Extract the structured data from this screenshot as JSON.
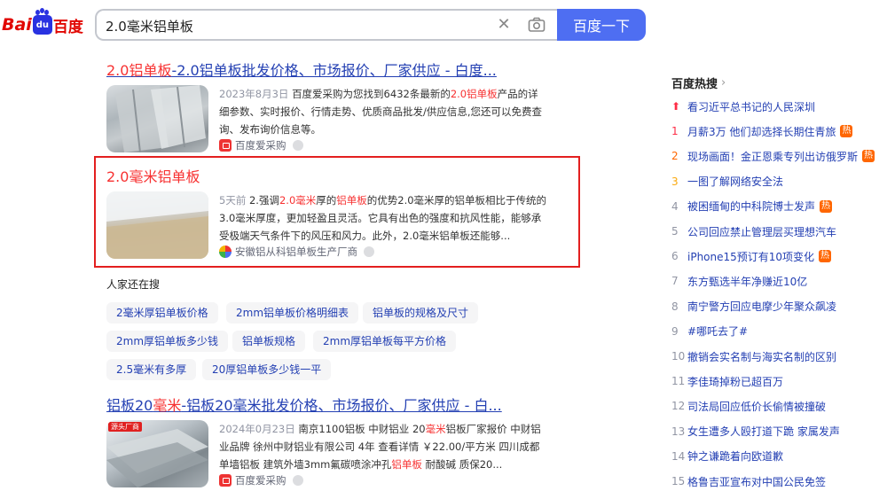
{
  "logo": {
    "bai": "Bai",
    "du": "du",
    "cn": "百度"
  },
  "search": {
    "query": "2.0毫米铝单板",
    "button": "百度一下"
  },
  "results": [
    {
      "title_hl": "2.0铝单板",
      "title_rest": "-2.0铝单板批发价格、市场报价、厂家供应 - 白度...",
      "date": "2023年8月3日",
      "desc_a": "百度爱采购为您找到6432条最新的",
      "desc_hl": "2.0铝单板",
      "desc_b": "产品的详细参数、实时报价、行情走势、优质商品批发/供应信息,您还可以免费查询、发布询价信息等。",
      "source": "百度爱采购"
    },
    {
      "title": "2.0毫米铝单板",
      "date": "5天前",
      "desc_a": "2.强调",
      "desc_hl1": "2.0毫米",
      "desc_b": "厚的",
      "desc_hl2": "铝单板",
      "desc_c": "的优势2.0毫米厚的铝单板相比于传统的3.0毫米厚度，更加轻盈且灵活。它具有出色的强度和抗风性能，能够承受极端天气条件下的风压和风力。此外，2.0毫米铝单板还能够...",
      "source": "安徽铝从科铝单板生产厂商"
    },
    {
      "title_a": "铝板20",
      "title_hl": "毫米",
      "title_rest": "-铝板20毫米批发价格、市场报价、厂家供应 - 白...",
      "thumb_badge": "源头厂商",
      "date": "2024年0月23日",
      "desc_a": "南京1100铝板 中财铝业 20",
      "desc_hl1": "毫米",
      "desc_b": "铝板厂家报价 中财铝业品牌 徐州中财铝业有限公司 4年 查看详情 ￥22.00/平方米 四川成都 单墙铝板 建筑外墙3mm氟碳喷涂冲孔",
      "desc_hl2": "铝单板",
      "desc_c": " 耐酸碱 质保20...",
      "source": "百度爱采购"
    }
  ],
  "related": {
    "title": "人家还在搜",
    "chips": [
      "2毫米厚铝单板价格",
      "2mm铝单板价格明细表",
      "铝单板的规格及尺寸",
      "2mm厚铝单板多少钱",
      "铝单板规格",
      "2mm厚铝单板每平方价格",
      "2.5毫米有多厚",
      "20厚铝单板多少钱一平"
    ]
  },
  "hot": {
    "title": "百度热搜",
    "items": [
      {
        "num": "",
        "label": "看习近平总书记的人民深圳",
        "badge": ""
      },
      {
        "num": "1",
        "label": "月薪3万 他们却选择长期住青旅",
        "badge": "热"
      },
      {
        "num": "2",
        "label": "现场画面！金正恩乘专列出访俄罗斯",
        "badge": "热"
      },
      {
        "num": "3",
        "label": "一图了解网络安全法",
        "badge": ""
      },
      {
        "num": "4",
        "label": "被困缅甸的中科院博士发声",
        "badge": "热"
      },
      {
        "num": "5",
        "label": "公司回应禁止管理层买理想汽车",
        "badge": ""
      },
      {
        "num": "6",
        "label": "iPhone15预订有10项变化",
        "badge": "热"
      },
      {
        "num": "7",
        "label": "东方甄选半年净赚近10亿",
        "badge": ""
      },
      {
        "num": "8",
        "label": "南宁警方回应电摩少年聚众飙凌",
        "badge": ""
      },
      {
        "num": "9",
        "label": "#哪吒去了#",
        "badge": ""
      },
      {
        "num": "10",
        "label": "撤销会实名制与海实名制的区别",
        "badge": ""
      },
      {
        "num": "11",
        "label": "李佳琦掉粉已超百万",
        "badge": ""
      },
      {
        "num": "12",
        "label": "司法局回应低价长偷情被撞破",
        "badge": ""
      },
      {
        "num": "13",
        "label": "女生遭多人殴打道下跪 家属发声",
        "badge": ""
      },
      {
        "num": "14",
        "label": "钟之谦跪着向欧道歉",
        "badge": ""
      },
      {
        "num": "15",
        "label": "格鲁吉亚宣布对中国公民免签",
        "badge": ""
      }
    ]
  }
}
